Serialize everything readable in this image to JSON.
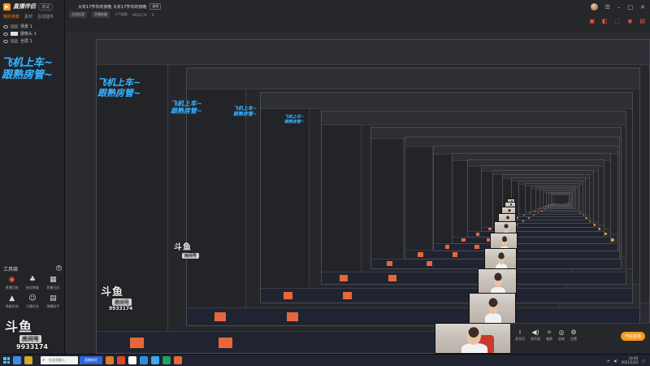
{
  "app": {
    "name": "直播伴侣",
    "version_badge": "测试"
  },
  "sidebar": {
    "tabs": [
      {
        "label": "我的场景",
        "active": true
      },
      {
        "label": "素材",
        "active": false
      },
      {
        "label": "互动插件",
        "active": false
      }
    ],
    "scenes": [
      {
        "label": "场景 1",
        "selected": false
      },
      {
        "label": "摄像头 1",
        "selected": true
      },
      {
        "label": "全屏 1",
        "selected": false
      }
    ],
    "overlay_text_line1": "飞机上车~",
    "overlay_text_line2": "跟熟房管~",
    "tools_header": "工具箱",
    "tools_add": "+",
    "tools": [
      {
        "label": "直播回放",
        "icon": "camera-icon",
        "glyph": "◉",
        "hot": true
      },
      {
        "label": "粉丝数据",
        "icon": "fans-icon",
        "glyph": "♣",
        "hot": false
      },
      {
        "label": "直播日历",
        "icon": "calendar-icon",
        "glyph": "▦",
        "hot": false
      },
      {
        "label": "高能时刻",
        "icon": "gift-icon",
        "glyph": "▲",
        "hot": false
      },
      {
        "label": "主播任务",
        "icon": "task-icon",
        "glyph": "☺",
        "hot": false
      },
      {
        "label": "弹幕助手",
        "icon": "chat-icon",
        "glyph": "▤",
        "hot": false
      }
    ],
    "watermark_big": "斗鱼",
    "watermark_label": "房间号",
    "watermark_room": "9933174"
  },
  "topbar": {
    "room_title": "大年17学年的夜晚 大年17学年的夜晚",
    "edit_label": "编辑",
    "meta": [
      "主机信息",
      "开播准备",
      "人气指数",
      "9933174",
      "0"
    ],
    "window_controls": [
      "☰",
      "–",
      "□",
      "✕"
    ],
    "tool_icons": [
      "▣",
      "◧",
      "⬚",
      "◉",
      "▤"
    ]
  },
  "stage": {
    "overlay_text_line1": "飞机上车~",
    "overlay_text_line2": "跟熟房管~",
    "watermark_big": "斗鱼",
    "watermark_label": "房间号",
    "watermark_room": "9933174"
  },
  "controls": [
    {
      "label": "麦克风",
      "icon": "mic-icon",
      "glyph": "♮"
    },
    {
      "label": "扬声器",
      "icon": "speaker-icon",
      "glyph": "◀)"
    },
    {
      "label": "美颜",
      "icon": "beauty-icon",
      "glyph": "✧"
    },
    {
      "label": "录制",
      "icon": "record-icon",
      "glyph": "◎"
    },
    {
      "label": "设置",
      "icon": "settings-icon",
      "glyph": "⚙"
    }
  ],
  "start_live": "开始直播",
  "taskbar": {
    "search_placeholder": "在这里输入",
    "active_app": "直播伴侣",
    "time": "14:40",
    "date": "2021/1/23"
  },
  "colors": {
    "accent": "#f39a1e",
    "overlay_blue": "#3ab4ff",
    "record_red": "#e8673a"
  }
}
